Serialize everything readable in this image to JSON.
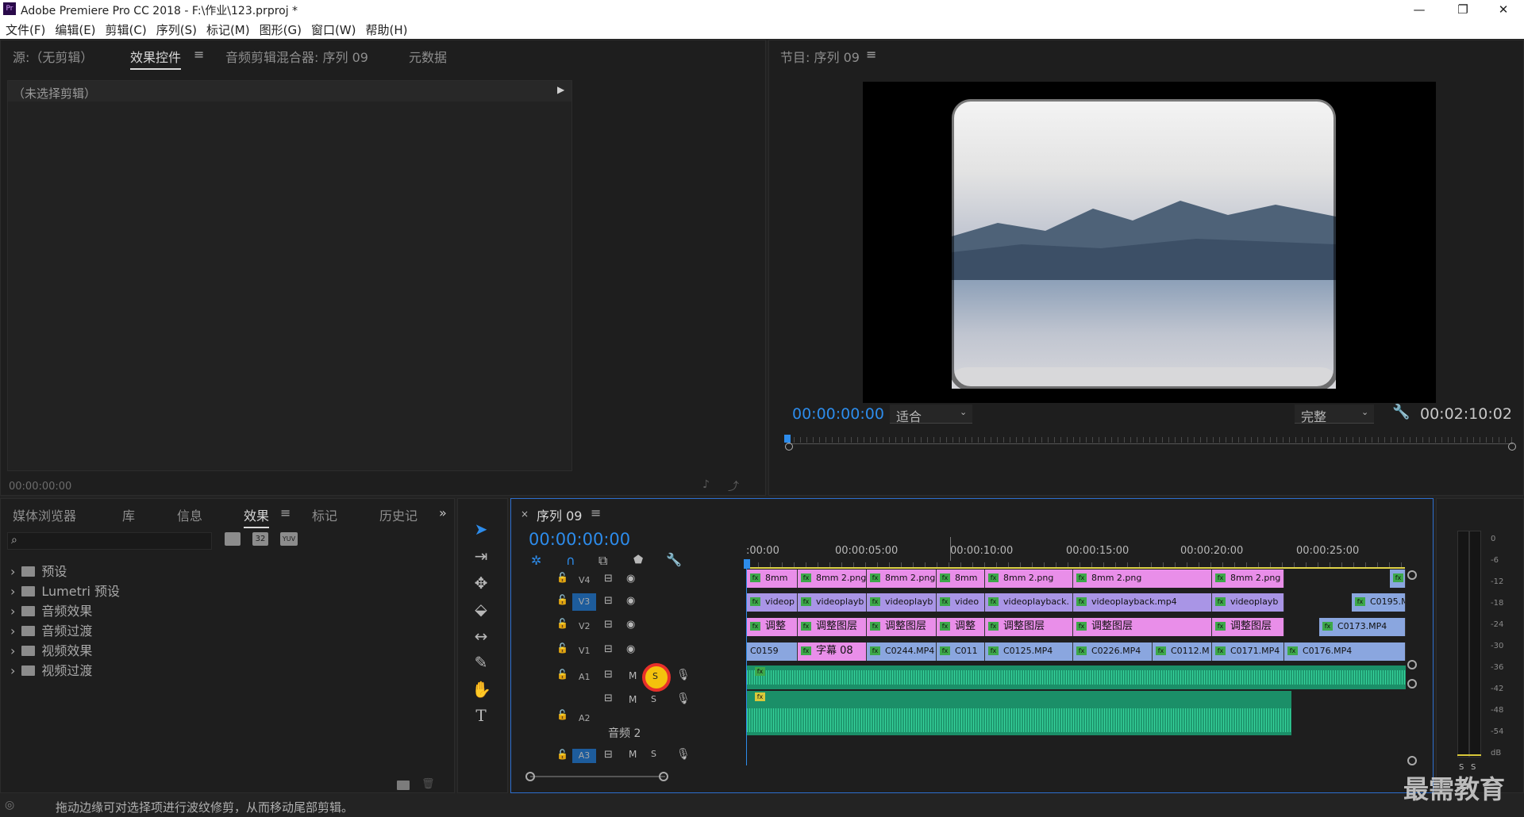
{
  "window": {
    "title": "Adobe Premiere Pro CC 2018 - F:\\作业\\123.prproj *",
    "app_icon": "Pr"
  },
  "menu": [
    "文件(F)",
    "编辑(E)",
    "剪辑(C)",
    "序列(S)",
    "标记(M)",
    "图形(G)",
    "窗口(W)",
    "帮助(H)"
  ],
  "source_panel": {
    "tabs": [
      "源:（无剪辑）",
      "效果控件",
      "音频剪辑混合器: 序列 09",
      "元数据"
    ],
    "no_clip": "（未选择剪辑）",
    "timecode": "00:00:00:00"
  },
  "program_monitor": {
    "title": "节目: 序列 09",
    "timecode": "00:00:00:00",
    "fit": "适合",
    "quality": "完整",
    "duration": "00:02:10:02",
    "playhead": 0.0
  },
  "project_panel": {
    "tabs": [
      "媒体浏览器",
      "库",
      "信息",
      "效果",
      "标记",
      "历史记"
    ],
    "folders": [
      "预设",
      "Lumetri 预设",
      "音频效果",
      "音频过渡",
      "视频效果",
      "视频过渡"
    ],
    "icon_labels": [
      "32",
      "YUV"
    ]
  },
  "timeline": {
    "tab": "序列 09",
    "timecode": "00:00:00:00",
    "ruler": [
      ":00:00",
      "00:00:05:00",
      "00:00:10:00",
      "00:00:15:00",
      "00:00:20:00",
      "00:00:25:00"
    ],
    "tracks": {
      "v4": "V4",
      "v3": "V3",
      "v2": "V2",
      "v1": "V1",
      "a1": "A1",
      "a2": "A2",
      "a3": "A3"
    },
    "track_btn": {
      "m": "M",
      "s": "S"
    },
    "a2_name": "音频 2",
    "v4_clips": [
      "8mm",
      "8mm 2.png",
      "8mm 2.png",
      "8mm",
      "8mm 2.png",
      "8mm 2.png",
      "8mm 2.png"
    ],
    "v3_clips": [
      "videop",
      "videoplayb",
      "videoplayb",
      "video",
      "videoplayback.",
      "videoplayback.mp4",
      "videoplayb",
      "C0195.M"
    ],
    "v2_clips": [
      "调整",
      "调整图层",
      "调整图层",
      "调整",
      "调整图层",
      "调整图层",
      "调整图层",
      "C0173.MP4"
    ],
    "v1_clips": [
      "C0159",
      "字幕 08",
      "C0244.MP4",
      "C011",
      "C0125.MP4",
      "C0226.MP4",
      "C0112.M",
      "C0171.MP4",
      "C0176.MP4"
    ]
  },
  "audio_meter": {
    "scale": [
      "0",
      "-6",
      "-12",
      "-18",
      "-24",
      "-30",
      "-36",
      "-42",
      "-48",
      "-54",
      "dB"
    ],
    "solo": [
      "S",
      "S"
    ]
  },
  "status_bar": "拖动边缘可对选择项进行波纹修剪，从而移动尾部剪辑。",
  "watermark": "最需教育",
  "colors": {
    "accent": "#2d8ceb",
    "pink_clip": "#e98ee9",
    "purple_clip": "#a995e6",
    "blue_clip": "#8aa6df",
    "audio": "#2fb386",
    "solo_highlight": "#f4c20d",
    "annotation_ring": "#e8302a"
  }
}
